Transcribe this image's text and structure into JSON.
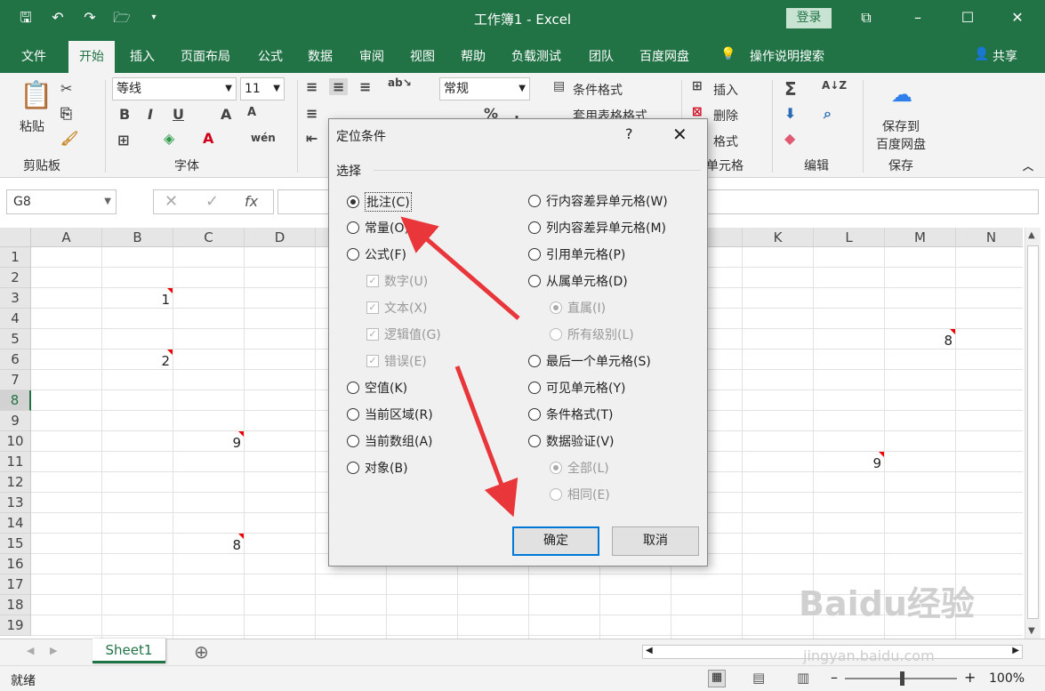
{
  "window": {
    "title": "工作簿1  -  Excel",
    "login": "登录"
  },
  "tabs": [
    "文件",
    "开始",
    "插入",
    "页面布局",
    "公式",
    "数据",
    "审阅",
    "视图",
    "帮助",
    "负载测试",
    "团队",
    "百度网盘"
  ],
  "tellme": "操作说明搜索",
  "share": "共享",
  "ribbon": {
    "paste": "粘贴",
    "clipboard": "剪贴板",
    "font_name": "等线",
    "font_size": "11",
    "font_group": "字体",
    "number_format": "常规",
    "cond_format": "条件格式",
    "table_format": "套用表格格式",
    "insert": "插入",
    "delete": "删除",
    "format": "格式",
    "cells_group": "单元格",
    "edit_group": "编辑",
    "save_baidu": "保存到\n百度网盘",
    "save_baidu_1": "保存到",
    "save_baidu_2": "百度网盘",
    "save_group": "保存"
  },
  "namebox": "G8",
  "fx": "fx",
  "columns": [
    "A",
    "B",
    "C",
    "D",
    "",
    "",
    "",
    "",
    "",
    "",
    "K",
    "L",
    "M",
    "N"
  ],
  "rows": [
    "1",
    "2",
    "3",
    "4",
    "5",
    "6",
    "7",
    "8",
    "9",
    "10",
    "11",
    "12",
    "13",
    "14",
    "15",
    "16",
    "17",
    "18",
    "19"
  ],
  "cells": [
    {
      "col": "B",
      "row": "3",
      "value": "1"
    },
    {
      "col": "B",
      "row": "6",
      "value": "2"
    },
    {
      "col": "C",
      "row": "10",
      "value": "9"
    },
    {
      "col": "C",
      "row": "15",
      "value": "8"
    },
    {
      "col": "M",
      "row": "5",
      "value": "8"
    },
    {
      "col": "L",
      "row": "11",
      "value": "9"
    }
  ],
  "sheet": {
    "name": "Sheet1"
  },
  "status": {
    "mode": "就绪",
    "zoom": "100%"
  },
  "dialog": {
    "title": "定位条件",
    "help": "?",
    "section": "选择",
    "left_options": [
      {
        "label": "批注(C)",
        "type": "radio",
        "checked": true
      },
      {
        "label": "常量(O)",
        "type": "radio"
      },
      {
        "label": "公式(F)",
        "type": "radio"
      },
      {
        "label": "数字(U)",
        "type": "check",
        "disabled": true
      },
      {
        "label": "文本(X)",
        "type": "check",
        "disabled": true
      },
      {
        "label": "逻辑值(G)",
        "type": "check",
        "disabled": true
      },
      {
        "label": "错误(E)",
        "type": "check",
        "disabled": true
      },
      {
        "label": "空值(K)",
        "type": "radio"
      },
      {
        "label": "当前区域(R)",
        "type": "radio"
      },
      {
        "label": "当前数组(A)",
        "type": "radio"
      },
      {
        "label": "对象(B)",
        "type": "radio"
      }
    ],
    "right_options": [
      {
        "label": "行内容差异单元格(W)",
        "type": "radio"
      },
      {
        "label": "列内容差异单元格(M)",
        "type": "radio"
      },
      {
        "label": "引用单元格(P)",
        "type": "radio"
      },
      {
        "label": "从属单元格(D)",
        "type": "radio"
      },
      {
        "label": "直属(I)",
        "type": "radio",
        "checked": true,
        "disabled": true
      },
      {
        "label": "所有级别(L)",
        "type": "radio",
        "disabled": true
      },
      {
        "label": "最后一个单元格(S)",
        "type": "radio"
      },
      {
        "label": "可见单元格(Y)",
        "type": "radio"
      },
      {
        "label": "条件格式(T)",
        "type": "radio"
      },
      {
        "label": "数据验证(V)",
        "type": "radio"
      },
      {
        "label": "全部(L)",
        "type": "radio",
        "checked": true,
        "disabled": true
      },
      {
        "label": "相同(E)",
        "type": "radio",
        "disabled": true
      }
    ],
    "ok": "确定",
    "cancel": "取消"
  },
  "watermark": {
    "brand": "Baidu经验",
    "url": "jingyan.baidu.com"
  },
  "colors": {
    "excel_green": "#217346",
    "arrow_red": "#e8363a"
  }
}
